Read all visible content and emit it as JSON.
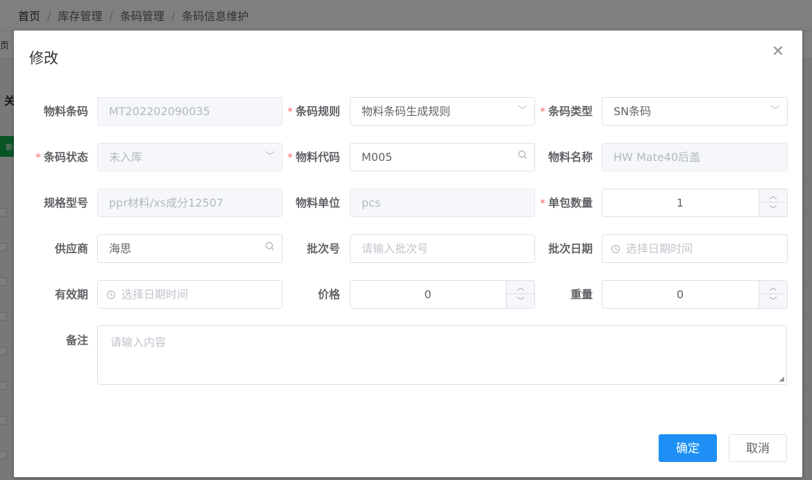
{
  "breadcrumb": [
    "首页",
    "库存管理",
    "条码管理",
    "条码信息维护"
  ],
  "background": {
    "tab_label": "页",
    "side_text": "关",
    "green_button_label": "新"
  },
  "dialog": {
    "title": "修改",
    "close_icon": "close-icon",
    "fields": {
      "material_barcode": {
        "label": "物料条码",
        "value": "MT202202090035"
      },
      "barcode_rule": {
        "label": "条码规则",
        "value": "物料条码生成规则"
      },
      "barcode_type": {
        "label": "条码类型",
        "value": "SN条码"
      },
      "barcode_status": {
        "label": "条码状态",
        "value": "未入库"
      },
      "material_code": {
        "label": "物料代码",
        "value": "M005"
      },
      "material_name": {
        "label": "物料名称",
        "value": "HW Mate40后盖"
      },
      "spec_model": {
        "label": "规格型号",
        "value": "ppr材料/xs成分12507"
      },
      "material_unit": {
        "label": "物料单位",
        "value": "pcs"
      },
      "pack_quantity": {
        "label": "单包数量",
        "value": "1"
      },
      "supplier": {
        "label": "供应商",
        "value": "海思"
      },
      "batch_no": {
        "label": "批次号",
        "placeholder": "请输入批次号"
      },
      "batch_date": {
        "label": "批次日期",
        "placeholder": "选择日期时间"
      },
      "expiry": {
        "label": "有效期",
        "placeholder": "选择日期时间"
      },
      "price": {
        "label": "价格",
        "value": "0"
      },
      "weight": {
        "label": "重量",
        "value": "0"
      },
      "remark": {
        "label": "备注",
        "placeholder": "请输入内容"
      }
    },
    "required_mark": "*",
    "buttons": {
      "confirm": "确定",
      "cancel": "取消"
    }
  }
}
